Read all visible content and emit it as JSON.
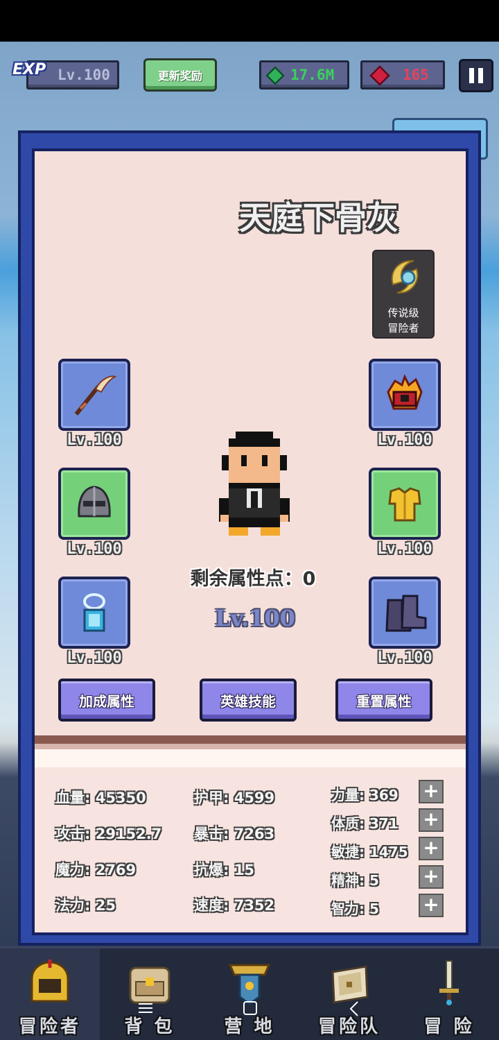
{
  "topbar": {
    "exp_badge": "EXP",
    "level": "Lv.100",
    "reward_button": "更新奖励",
    "gems": "17.6M",
    "rubies": "165"
  },
  "hero": {
    "name": "天庭下骨灰",
    "rank_line1": "传说级",
    "rank_line2": "冒险者",
    "points_label": "剩余属性点：",
    "points_value": "0",
    "level": "Lv.100"
  },
  "equipment": [
    {
      "slot": "weapon",
      "level": "Lv.100",
      "rarity": "blue",
      "icon": "scythe-icon"
    },
    {
      "slot": "helmet",
      "level": "Lv.100",
      "rarity": "green",
      "icon": "helmet-icon"
    },
    {
      "slot": "necklace",
      "level": "Lv.100",
      "rarity": "blue",
      "icon": "necklace-icon"
    },
    {
      "slot": "offhand",
      "level": "Lv.100",
      "rarity": "blue",
      "icon": "fire-gem-icon"
    },
    {
      "slot": "armor",
      "level": "Lv.100",
      "rarity": "green",
      "icon": "armor-icon"
    },
    {
      "slot": "boots",
      "level": "Lv.100",
      "rarity": "blue",
      "icon": "boots-icon"
    }
  ],
  "actions": {
    "bonus": "加成属性",
    "skills": "英雄技能",
    "reset": "重置属性"
  },
  "stats": {
    "hp": "血量: 45350",
    "armor": "护甲: 4599",
    "attack": "攻击: 29152.7",
    "crit": "暴击: 7263",
    "magic": "魔力: 2769",
    "crit_resist": "抗爆: 15",
    "mana": "法力: 25",
    "speed": "速度: 7352"
  },
  "attributes": [
    {
      "label": "力量: 369"
    },
    {
      "label": "体质: 371"
    },
    {
      "label": "敏捷: 1475"
    },
    {
      "label": "精神: 5"
    },
    {
      "label": "智力: 5"
    }
  ],
  "plus_symbol": "+",
  "nav": [
    {
      "label": "冒险者",
      "icon": "crown-helmet-icon",
      "active": true
    },
    {
      "label": "背 包",
      "icon": "backpack-icon",
      "active": false
    },
    {
      "label": "营 地",
      "icon": "camp-banner-icon",
      "active": false
    },
    {
      "label": "冒险队",
      "icon": "chest-icon",
      "active": false
    },
    {
      "label": "冒 险",
      "icon": "sword-icon",
      "active": false
    }
  ],
  "colors": {
    "panel_blue": "#2f49a8",
    "panel_bg": "#f5dfdb",
    "button_purple": "#8e86e8",
    "rarity_blue": "#6f8ad8",
    "rarity_green": "#74d17a",
    "gem_green": "#3ccf5e",
    "ruby_red": "#e8425c"
  }
}
